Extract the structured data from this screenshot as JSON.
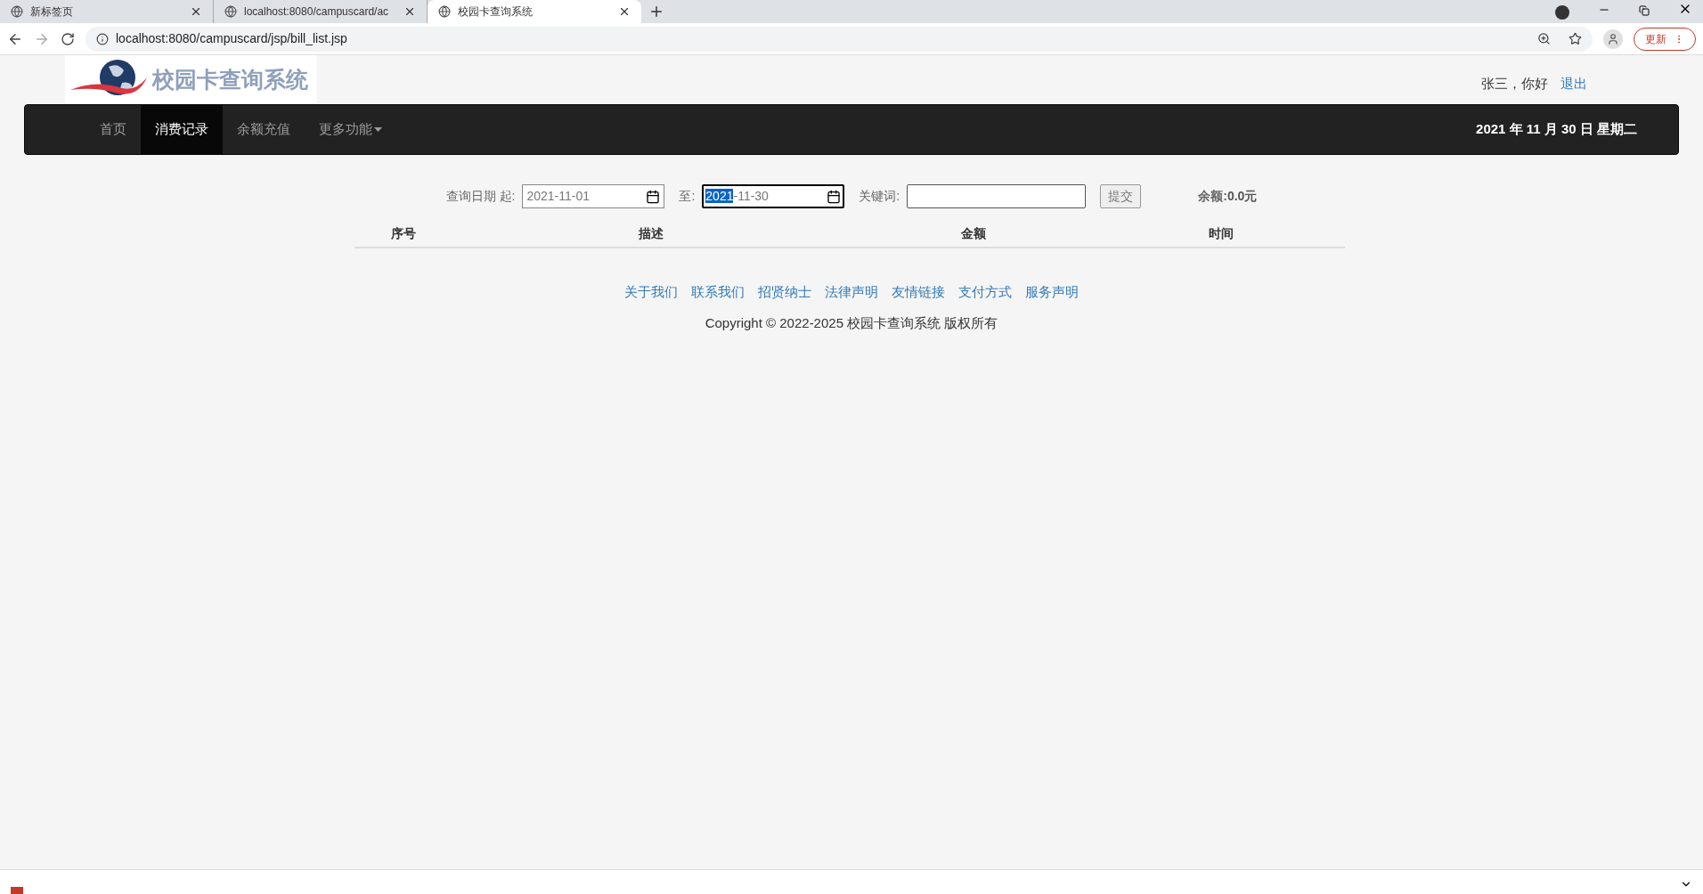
{
  "browser": {
    "tabs": [
      {
        "title": "新标签页",
        "selected": false
      },
      {
        "title": "localhost:8080/campuscard/ac",
        "selected": false
      },
      {
        "title": "校园卡查询系统",
        "selected": true
      }
    ],
    "url": "localhost:8080/campuscard/jsp/bill_list.jsp",
    "update_button": "更新"
  },
  "header": {
    "logo_text": "校园卡查询系统",
    "greeting": "张三，你好",
    "logout": "退出"
  },
  "nav": {
    "items": [
      {
        "label": "首页",
        "selected": false,
        "kind": "link"
      },
      {
        "label": "消费记录",
        "selected": true,
        "kind": "link"
      },
      {
        "label": "余额充值",
        "selected": false,
        "kind": "link"
      },
      {
        "label": "更多功能",
        "selected": false,
        "kind": "dropdown"
      }
    ],
    "date": "2021 年 11 月 30 日 星期二"
  },
  "filter": {
    "start_label": "查询日期 起:",
    "start_value": "2021-11-01",
    "end_label": "至:",
    "end_value": "2021-11-30",
    "keyword_label": "关键词:",
    "submit": "提交",
    "balance_label": "余额:",
    "balance_value": "0.0元"
  },
  "table": {
    "columns": [
      "序号",
      "描述",
      "金额",
      "时间"
    ]
  },
  "footer": {
    "links": [
      "关于我们",
      "联系我们",
      "招贤纳士",
      "法律声明",
      "友情链接",
      "支付方式",
      "服务声明"
    ],
    "copyright": "Copyright © 2022-2025 校园卡查询系统 版权所有"
  }
}
